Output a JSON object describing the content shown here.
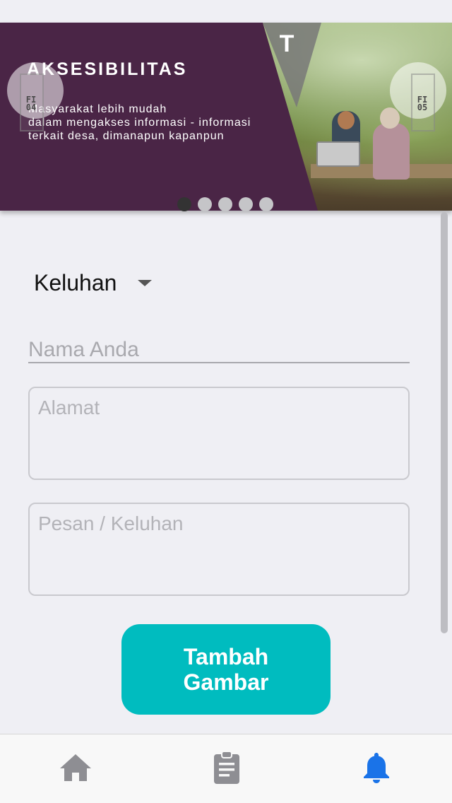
{
  "banner": {
    "title": "AKSESIBILITAS",
    "line1": "Masyarakat lebih mudah",
    "line2": "dalam mengakses informasi - informasi",
    "line3": "terkait desa, dimanapun kapanpun",
    "logo_text": "T",
    "prev_label": "FI\n04",
    "next_label": "FI\n05",
    "slide_count": 5,
    "active_slide": 1,
    "panel_color": "#4a2546"
  },
  "form": {
    "category_value": "Keluhan",
    "name_placeholder": "Nama Anda",
    "address_placeholder": "Alamat",
    "message_placeholder": "Pesan / Keluhan",
    "add_image_label": "Tambah Gambar",
    "accent_color": "#00bcbf"
  },
  "tabbar": {
    "items": [
      {
        "icon": "home-icon",
        "active": false
      },
      {
        "icon": "clipboard-icon",
        "active": false
      },
      {
        "icon": "bell-icon",
        "active": true
      }
    ],
    "active_color": "#1a73e8",
    "inactive_color": "#8e8e93"
  }
}
